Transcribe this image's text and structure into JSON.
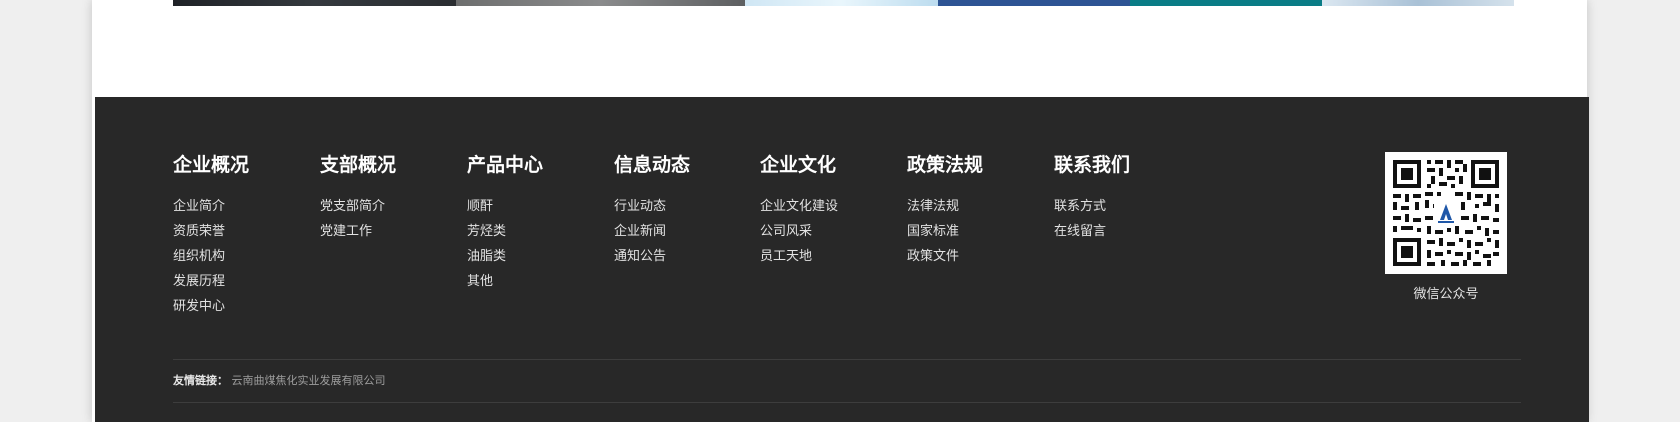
{
  "footer": {
    "nav": [
      {
        "title": "企业概况",
        "items": [
          "企业简介",
          "资质荣誉",
          "组织机构",
          "发展历程",
          "研发中心"
        ]
      },
      {
        "title": "支部概况",
        "items": [
          "党支部简介",
          "党建工作"
        ]
      },
      {
        "title": "产品中心",
        "items": [
          "顺酐",
          "芳烃类",
          "油脂类",
          "其他"
        ]
      },
      {
        "title": "信息动态",
        "items": [
          "行业动态",
          "企业新闻",
          "通知公告"
        ]
      },
      {
        "title": "企业文化",
        "items": [
          "企业文化建设",
          "公司风采",
          "员工天地"
        ]
      },
      {
        "title": "政策法规",
        "items": [
          "法律法规",
          "国家标准",
          "政策文件"
        ]
      },
      {
        "title": "联系我们",
        "items": [
          "联系方式",
          "在线留言"
        ]
      }
    ],
    "qr": {
      "caption": "微信公众号",
      "icon": "qr-code-icon"
    },
    "friend_links": {
      "label": "友情链接：",
      "items": [
        "云南曲煤焦化实业发展有限公司"
      ]
    }
  },
  "colors": {
    "footer_bg": "#282828",
    "title": "#ffffff",
    "link": "#e2e2e2",
    "muted": "#9d9d9d"
  }
}
